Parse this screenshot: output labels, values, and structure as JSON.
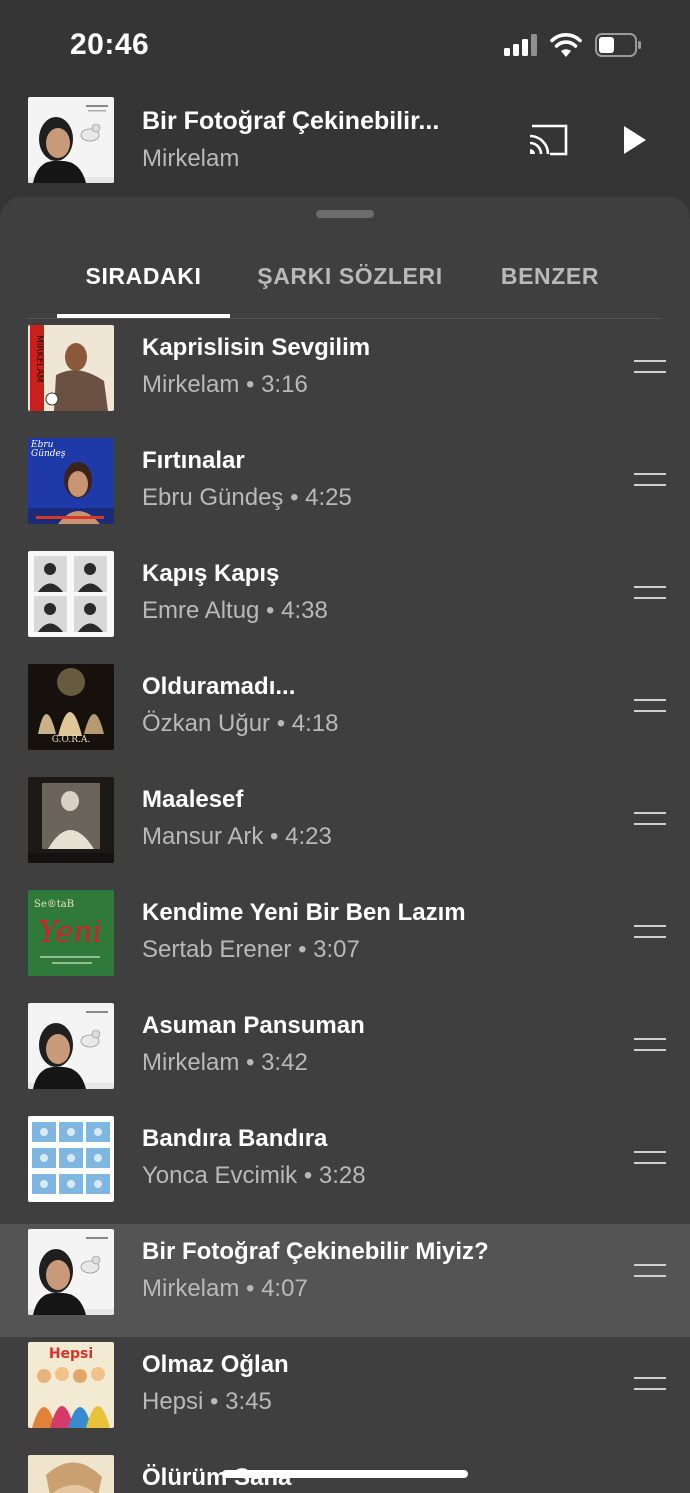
{
  "status_bar": {
    "time": "20:46"
  },
  "now_playing": {
    "title": "Bir Fotoğraf Çekinebilir...",
    "artist": "Mirkelam"
  },
  "tabs": [
    {
      "label": "SIRADAKI",
      "active": true
    },
    {
      "label": "ŞARKI SÖZLERI",
      "active": false
    },
    {
      "label": "BENZER",
      "active": false
    }
  ],
  "queue": [
    {
      "title": "Kaprislisin Sevgilim",
      "subtitle": "Mirkelam • 3:16",
      "art": "mirkelam-red"
    },
    {
      "title": "Fırtınalar",
      "subtitle": "Ebru Gündeş • 4:25",
      "art": "ebru-blue"
    },
    {
      "title": "Kapış Kapış",
      "subtitle": "Emre Altug • 4:38",
      "art": "emre-grid"
    },
    {
      "title": "Olduramadı...",
      "subtitle": "Özkan Uğur • 4:18",
      "art": "gora-dark"
    },
    {
      "title": "Maalesef",
      "subtitle": "Mansur Ark • 4:23",
      "art": "mansur-dark"
    },
    {
      "title": "Kendime Yeni Bir Ben Lazım",
      "subtitle": "Sertab Erener • 3:07",
      "art": "sertab-green"
    },
    {
      "title": "Asuman Pansuman",
      "subtitle": "Mirkelam • 3:42",
      "art": "mirkelam-bird"
    },
    {
      "title": "Bandıra Bandıra",
      "subtitle": "Yonca Evcimik • 3:28",
      "art": "yonca-grid"
    },
    {
      "title": "Bir Fotoğraf Çekinebilir Miyiz?",
      "subtitle": "Mirkelam • 4:07",
      "art": "mirkelam-bird",
      "current": true
    },
    {
      "title": "Olmaz Oğlan",
      "subtitle": "Hepsi • 3:45",
      "art": "hepsi-colorful"
    },
    {
      "title": "Ölürüm Sana",
      "subtitle": "",
      "art": "face-light"
    }
  ],
  "colors": {
    "background": "#353535",
    "sheet": "#3f3f3f",
    "current_row": "#545454",
    "secondary_text": "#b9b9b9"
  }
}
